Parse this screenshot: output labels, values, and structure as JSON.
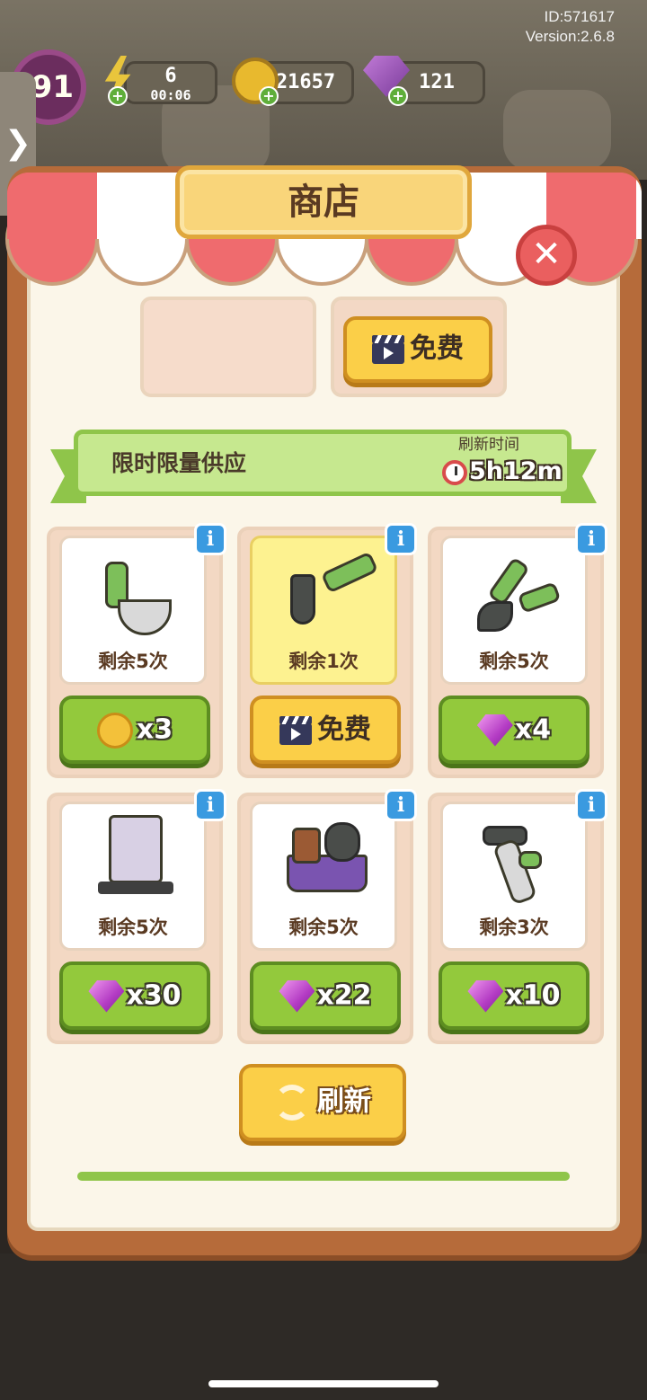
{
  "header": {
    "id_text": "ID:571617",
    "version_text": "Version:2.6.8",
    "side_tab_glyph": "❯",
    "level": "91",
    "energy": {
      "value": "6",
      "timer": "00:06"
    },
    "coins": "21657",
    "gems": "121",
    "plus_glyph": "+"
  },
  "shop": {
    "title": "商店",
    "close_glyph": "✕",
    "prev_free_label": "免费",
    "section_title": "限时限量供应",
    "refresh_time_label": "刷新时间",
    "refresh_timer": "5h12m",
    "info_glyph": "i",
    "refresh_button": "刷新",
    "items": [
      {
        "remaining": "剩余5次",
        "price_type": "coin",
        "price": "x3"
      },
      {
        "remaining": "剩余1次",
        "price_type": "free",
        "price": "免费"
      },
      {
        "remaining": "剩余5次",
        "price_type": "gem",
        "price": "x4"
      },
      {
        "remaining": "剩余5次",
        "price_type": "gem",
        "price": "x30"
      },
      {
        "remaining": "剩余5次",
        "price_type": "gem",
        "price": "x22"
      },
      {
        "remaining": "剩余3次",
        "price_type": "gem",
        "price": "x10"
      }
    ]
  },
  "colors": {
    "awning_red": "#ef6b6e",
    "panel_brown": "#b66b3a",
    "button_green": "#93c93c",
    "button_yellow": "#fbcf48",
    "gem_purple": "#b33bc3"
  }
}
